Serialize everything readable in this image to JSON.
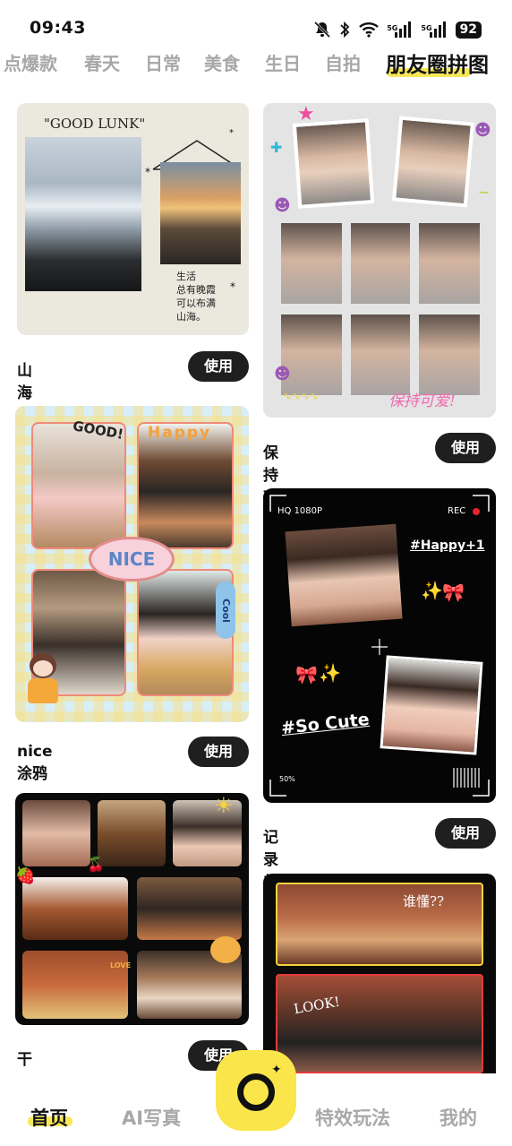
{
  "status": {
    "time": "09:43",
    "battery": "92",
    "net1": "5G",
    "net2": "5G"
  },
  "tabs": [
    "点爆款",
    "春天",
    "日常",
    "美食",
    "生日",
    "自拍",
    "朋友圈拼图"
  ],
  "cards": {
    "shanhai": {
      "title": "山海",
      "button": "使用",
      "caption": "\"GOOD LUNK\"",
      "note": [
        "生活",
        "总有晚霞",
        "可以布满",
        "山海。"
      ]
    },
    "baochi": {
      "title": "保持可爱",
      "button": "使用",
      "sticker": "保持可爱!"
    },
    "nice": {
      "title": "nice涂鸦",
      "button": "使用",
      "stickers": [
        "GOOD!",
        "Happy",
        "NICE",
        "Cool"
      ]
    },
    "jilu": {
      "title": "记录美好",
      "button": "使用",
      "hud_left": "HQ 1080P",
      "hud_right": "REC",
      "battery_text": "50%",
      "tag1": "#Happy+1",
      "tag2": "#So Cute"
    },
    "ganfan": {
      "title": "干饭七图",
      "button": "使用",
      "sticker": "LOVE"
    },
    "shui": {
      "sticker1": "谁懂??",
      "sticker2": "LOOK!"
    }
  },
  "nav": {
    "home": "首页",
    "ai": "AI写真",
    "effects": "特效玩法",
    "mine": "我的"
  },
  "colors": {
    "accent": "#fae54b",
    "button_bg": "#1f1f1f",
    "tab_inactive": "#a7a7a7"
  }
}
